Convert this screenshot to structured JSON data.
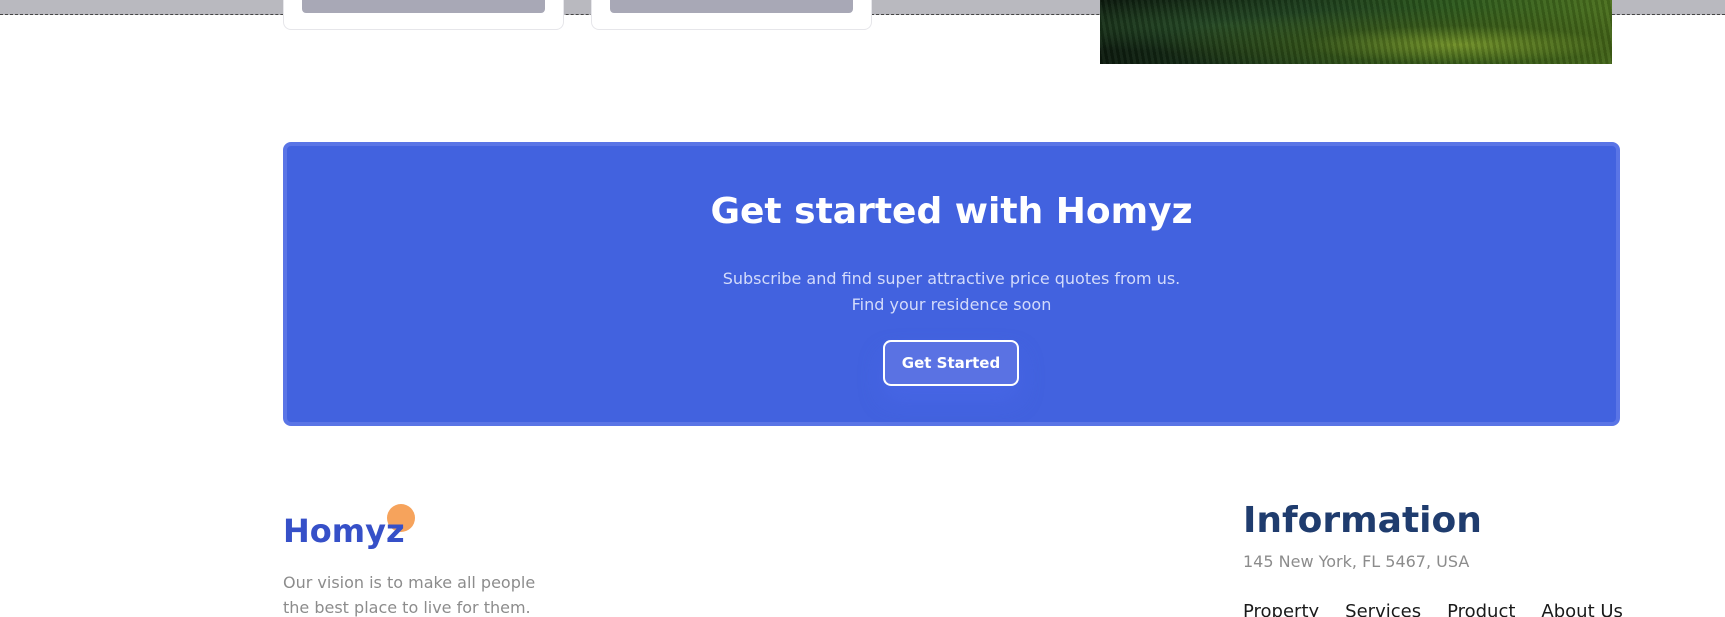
{
  "cta": {
    "title": "Get started with Homyz",
    "subtitle_line1": "Subscribe and find super attractive price quotes from us.",
    "subtitle_line2": "Find your residence soon",
    "button_label": "Get Started"
  },
  "footer": {
    "logo_text": "Homyz",
    "vision_line1": "Our vision is to make all people",
    "vision_line2": "the best place to live for them.",
    "info_title": "Information",
    "address": "145 New York, FL 5467, USA",
    "links": [
      "Property",
      "Services",
      "Product",
      "About Us"
    ]
  },
  "colors": {
    "banner_bg": "#4262df",
    "brand_blue": "#3650c8",
    "logo_accent": "#f6a35c",
    "heading_navy": "#1f3c6e"
  }
}
